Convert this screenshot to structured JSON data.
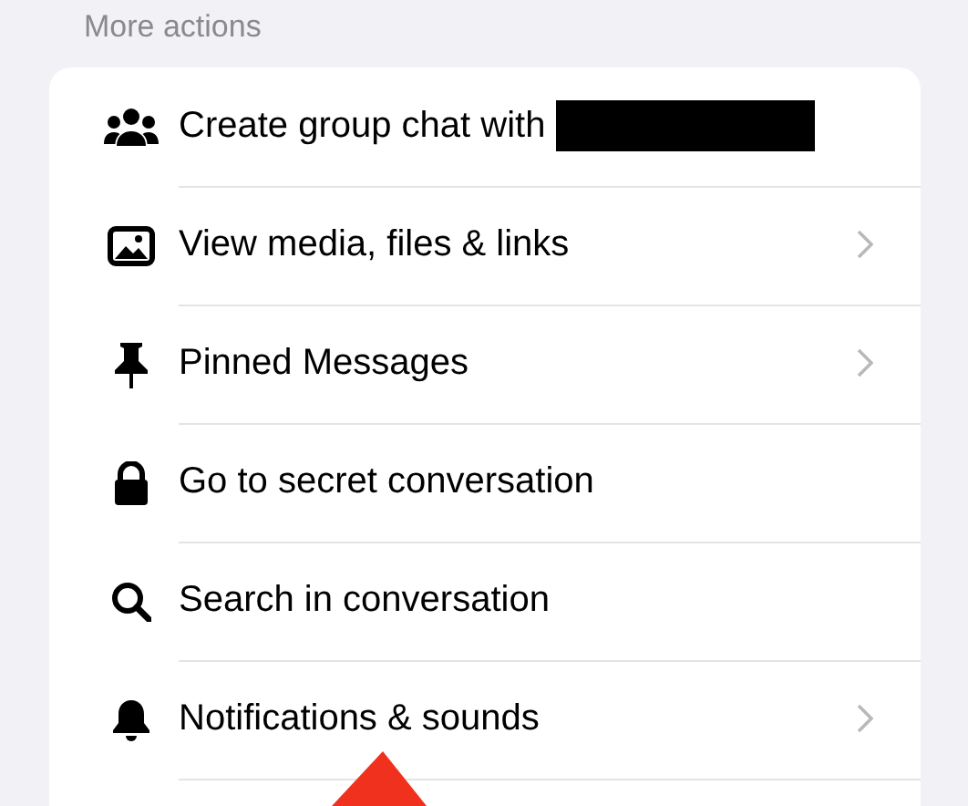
{
  "section_title": "More actions",
  "items": [
    {
      "kind": "group",
      "label": "Create group chat with",
      "redacted": true,
      "chevron": false
    },
    {
      "kind": "image",
      "label": "View media, files & links",
      "redacted": false,
      "chevron": true
    },
    {
      "kind": "pin",
      "label": "Pinned Messages",
      "redacted": false,
      "chevron": true
    },
    {
      "kind": "lock",
      "label": "Go to secret conversation",
      "redacted": false,
      "chevron": false
    },
    {
      "kind": "search",
      "label": "Search in conversation",
      "redacted": false,
      "chevron": false
    },
    {
      "kind": "bell",
      "label": "Notifications & sounds",
      "redacted": false,
      "chevron": true
    }
  ]
}
